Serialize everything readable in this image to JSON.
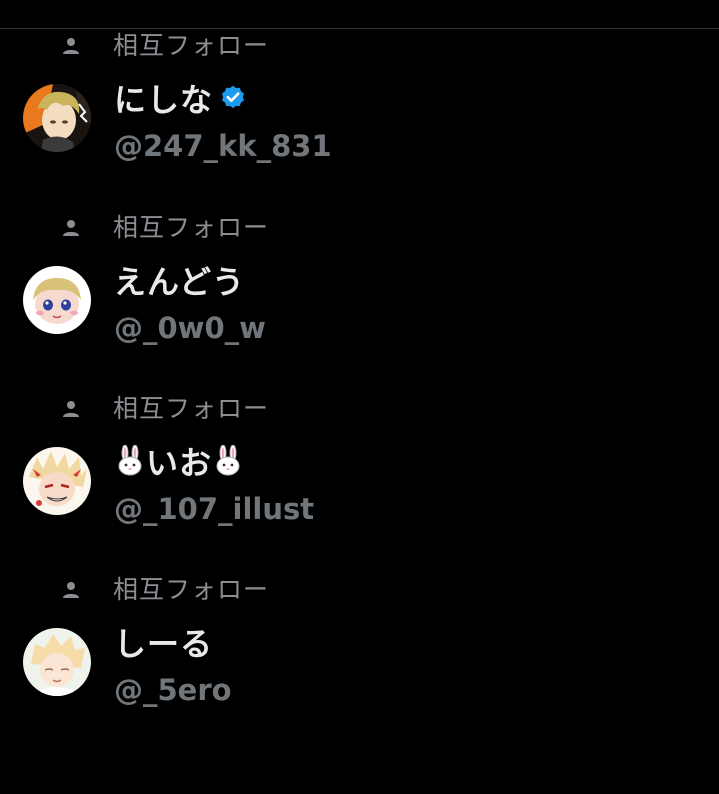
{
  "colors": {
    "background": "#000000",
    "primary_text": "#e7e9ea",
    "secondary_text": "#71767b",
    "verified": "#1d9bf0",
    "divider": "#2f3336"
  },
  "users": [
    {
      "mutual_label": "相互フォロー",
      "name": "にしな",
      "verified": true,
      "handle": "@247_kk_831",
      "avatar_icon": "avatar-image"
    },
    {
      "mutual_label": "相互フォロー",
      "name": "えんどう",
      "verified": false,
      "handle": "@_0w0_w",
      "avatar_icon": "avatar-image"
    },
    {
      "mutual_label": "相互フォロー",
      "name_prefix_icon": "rabbit-icon",
      "name": "いお",
      "name_suffix_icon": "rabbit-icon",
      "verified": false,
      "handle": "@_107_illust",
      "avatar_icon": "avatar-image"
    },
    {
      "mutual_label": "相互フォロー",
      "name": "しーる",
      "verified": false,
      "handle": "@_5ero",
      "avatar_icon": "avatar-image"
    }
  ]
}
